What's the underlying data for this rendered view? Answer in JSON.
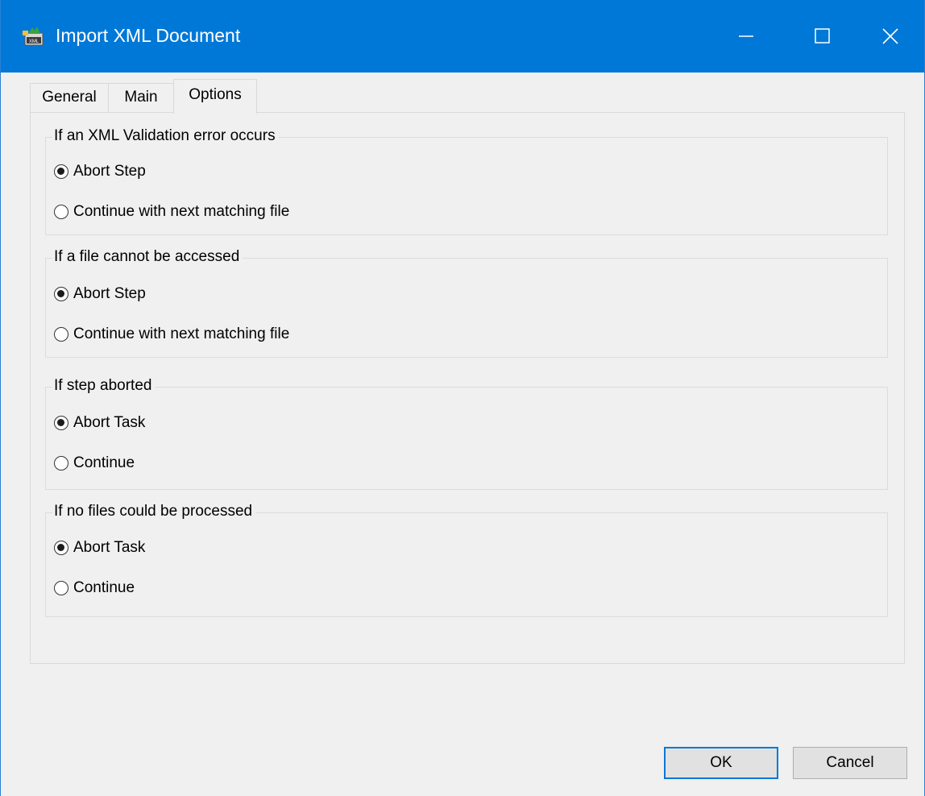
{
  "window": {
    "title": "Import XML Document",
    "titlebar_color": "#0078d7",
    "icon": "xml-document-icon"
  },
  "tabs": [
    {
      "label": "General",
      "selected": false
    },
    {
      "label": "Main",
      "selected": false
    },
    {
      "label": "Options",
      "selected": true
    }
  ],
  "groups": [
    {
      "title": "If an XML Validation error occurs",
      "options": [
        {
          "label": "Abort Step",
          "checked": true
        },
        {
          "label": "Continue with next matching file",
          "checked": false
        }
      ]
    },
    {
      "title": "If a file cannot be accessed",
      "options": [
        {
          "label": "Abort Step",
          "checked": true
        },
        {
          "label": "Continue with next matching file",
          "checked": false
        }
      ]
    },
    {
      "title": "If step aborted",
      "options": [
        {
          "label": "Abort Task",
          "checked": true
        },
        {
          "label": "Continue",
          "checked": false
        }
      ]
    },
    {
      "title": "If no files could be processed",
      "options": [
        {
          "label": "Abort Task",
          "checked": true
        },
        {
          "label": "Continue",
          "checked": false
        }
      ]
    }
  ],
  "buttons": {
    "ok_label": "OK",
    "cancel_label": "Cancel"
  }
}
